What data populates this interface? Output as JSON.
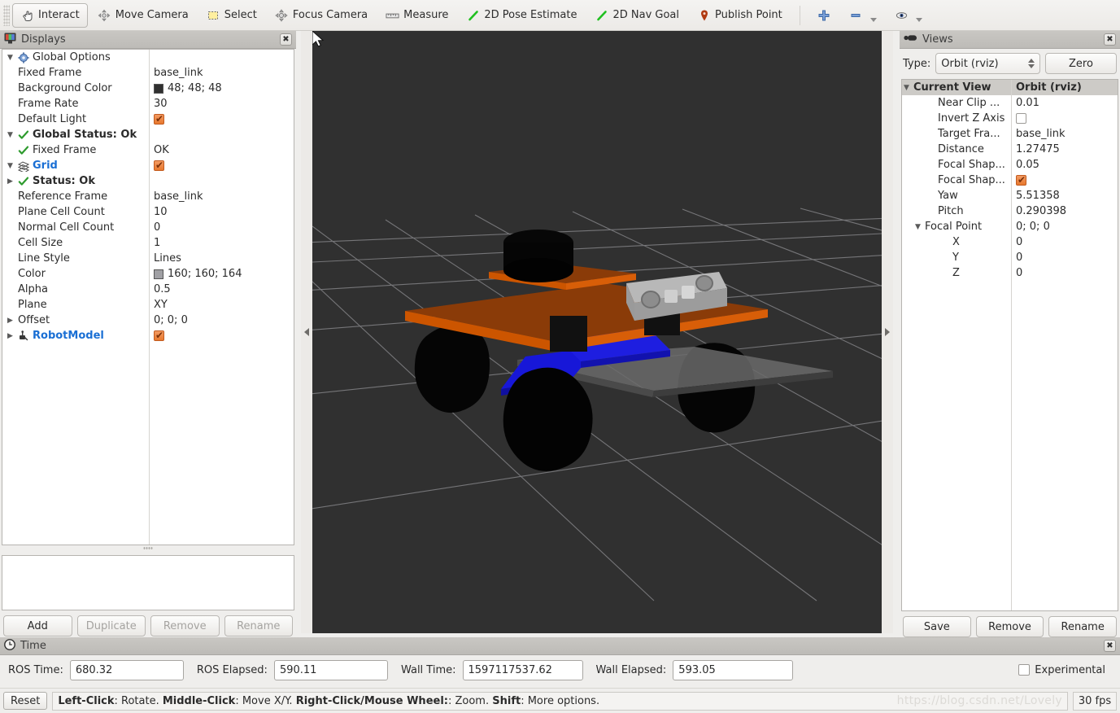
{
  "toolbar": {
    "items": [
      {
        "label": "Interact",
        "icon": "hand-icon",
        "active": true
      },
      {
        "label": "Move Camera",
        "icon": "move-camera-icon",
        "active": false
      },
      {
        "label": "Select",
        "icon": "select-icon",
        "active": false
      },
      {
        "label": "Focus Camera",
        "icon": "focus-camera-icon",
        "active": false
      },
      {
        "label": "Measure",
        "icon": "measure-icon",
        "active": false
      },
      {
        "label": "2D Pose Estimate",
        "icon": "pose-estimate-icon",
        "active": false
      },
      {
        "label": "2D Nav Goal",
        "icon": "nav-goal-icon",
        "active": false
      },
      {
        "label": "Publish Point",
        "icon": "publish-point-icon",
        "active": false
      }
    ],
    "right_icons": [
      "plus-icon",
      "minus-icon",
      "eye-icon"
    ]
  },
  "displays": {
    "title": "Displays",
    "title_icon": "displays-monitor-icon",
    "close_icon": "close-icon",
    "rows": [
      {
        "indent": 1,
        "tri": "▼",
        "icon": "gear-icon",
        "label": "Global Options",
        "value": "",
        "bold": false,
        "blue": false
      },
      {
        "indent": 2,
        "tri": "",
        "icon": "",
        "label": "Fixed Frame",
        "value": "base_link"
      },
      {
        "indent": 2,
        "tri": "",
        "icon": "",
        "label": "Background Color",
        "value": "48; 48; 48",
        "swatch": "#303030"
      },
      {
        "indent": 2,
        "tri": "",
        "icon": "",
        "label": "Frame Rate",
        "value": "30"
      },
      {
        "indent": 2,
        "tri": "",
        "icon": "",
        "label": "Default Light",
        "value": "",
        "checkbox": "on"
      },
      {
        "indent": 1,
        "tri": "▼",
        "icon": "check-icon",
        "label": "Global Status: Ok",
        "value": "",
        "bold": true
      },
      {
        "indent": 2,
        "tri": "",
        "icon": "check-icon",
        "label": "Fixed Frame",
        "value": "OK"
      },
      {
        "indent": 1,
        "tri": "▼",
        "icon": "grid-icon",
        "label": "Grid",
        "value": "",
        "blue": true,
        "checkbox": "on"
      },
      {
        "indent": 2,
        "tri": "▶",
        "icon": "check-icon",
        "label": "Status: Ok",
        "value": "",
        "bold": true
      },
      {
        "indent": 2,
        "tri": "",
        "icon": "",
        "label": "Reference Frame",
        "value": "base_link"
      },
      {
        "indent": 2,
        "tri": "",
        "icon": "",
        "label": "Plane Cell Count",
        "value": "10"
      },
      {
        "indent": 2,
        "tri": "",
        "icon": "",
        "label": "Normal Cell Count",
        "value": "0"
      },
      {
        "indent": 2,
        "tri": "",
        "icon": "",
        "label": "Cell Size",
        "value": "1"
      },
      {
        "indent": 2,
        "tri": "",
        "icon": "",
        "label": "Line Style",
        "value": "Lines"
      },
      {
        "indent": 2,
        "tri": "",
        "icon": "",
        "label": "Color",
        "value": "160; 160; 164",
        "swatch": "#a0a0a4"
      },
      {
        "indent": 2,
        "tri": "",
        "icon": "",
        "label": "Alpha",
        "value": "0.5"
      },
      {
        "indent": 2,
        "tri": "",
        "icon": "",
        "label": "Plane",
        "value": "XY"
      },
      {
        "indent": 2,
        "tri": "▶",
        "icon": "",
        "label": "Offset",
        "value": "0; 0; 0"
      },
      {
        "indent": 1,
        "tri": "▶",
        "icon": "robot-icon",
        "label": "RobotModel",
        "value": "",
        "blue": true,
        "checkbox": "on"
      }
    ],
    "buttons": [
      {
        "label": "Add",
        "enabled": true
      },
      {
        "label": "Duplicate",
        "enabled": false
      },
      {
        "label": "Remove",
        "enabled": false
      },
      {
        "label": "Rename",
        "enabled": false
      }
    ]
  },
  "views": {
    "title": "Views",
    "title_icon": "camera-icon",
    "close_icon": "close-icon",
    "type_label": "Type:",
    "type_value": "Orbit (rviz)",
    "zero_button": "Zero",
    "header": {
      "name": "Current View",
      "value": "Orbit (rviz)",
      "tri": "▼"
    },
    "rows": [
      {
        "indent": 3,
        "tri": "",
        "label": "Near Clip ...",
        "value": "0.01"
      },
      {
        "indent": 3,
        "tri": "",
        "label": "Invert Z Axis",
        "value": "",
        "checkbox": "off"
      },
      {
        "indent": 3,
        "tri": "",
        "label": "Target Fra...",
        "value": "base_link"
      },
      {
        "indent": 3,
        "tri": "",
        "label": "Distance",
        "value": "1.27475"
      },
      {
        "indent": 3,
        "tri": "",
        "label": "Focal Shap...",
        "value": "0.05"
      },
      {
        "indent": 3,
        "tri": "",
        "label": "Focal Shap...",
        "value": "",
        "checkbox": "on"
      },
      {
        "indent": 3,
        "tri": "",
        "label": "Yaw",
        "value": "5.51358"
      },
      {
        "indent": 3,
        "tri": "",
        "label": "Pitch",
        "value": "0.290398"
      },
      {
        "indent": 2,
        "tri": "▼",
        "label": "Focal Point",
        "value": "0; 0; 0"
      },
      {
        "indent": 4,
        "tri": "",
        "label": "X",
        "value": "0"
      },
      {
        "indent": 4,
        "tri": "",
        "label": "Y",
        "value": "0"
      },
      {
        "indent": 4,
        "tri": "",
        "label": "Z",
        "value": "0"
      }
    ],
    "buttons": [
      {
        "label": "Save"
      },
      {
        "label": "Remove"
      },
      {
        "label": "Rename"
      }
    ]
  },
  "time": {
    "title": "Time",
    "title_icon": "clock-icon",
    "close_icon": "close-icon",
    "fields": [
      {
        "label": "ROS Time:",
        "value": "680.32"
      },
      {
        "label": "ROS Elapsed:",
        "value": "590.11"
      },
      {
        "label": "Wall Time:",
        "value": "1597117537.62"
      },
      {
        "label": "Wall Elapsed:",
        "value": "593.05"
      }
    ],
    "experimental_label": "Experimental",
    "experimental_checked": false
  },
  "status": {
    "reset_button": "Reset",
    "hint_segments": [
      {
        "text": "Left-Click",
        "bold": true
      },
      {
        "text": ": Rotate.  ",
        "bold": false
      },
      {
        "text": "Middle-Click",
        "bold": true
      },
      {
        "text": ": Move X/Y.  ",
        "bold": false
      },
      {
        "text": "Right-Click/Mouse Wheel:",
        "bold": true
      },
      {
        "text": ": Zoom.  ",
        "bold": false
      },
      {
        "text": "Shift",
        "bold": true
      },
      {
        "text": ": More options.",
        "bold": false
      }
    ],
    "watermark": "https://blog.csdn.net/Lovely",
    "fps": "30 fps"
  },
  "viewport": {
    "background_color": "#303030",
    "grid_color": "#a0a0a4",
    "robot": {
      "plate_color": "#cc5500",
      "plate_top_color": "#8a3b08",
      "chassis_color": "#555555",
      "wheel_color": "#050505",
      "sensor_color": "#b0b0b0",
      "blue_part_color": "#1414d8"
    }
  },
  "colors": {
    "accent": "#cc5500",
    "link": "#1a6fd4",
    "ok": "#2e9b2e",
    "panel_bg": "#efeeec",
    "titlebar": "#c3c1bd"
  }
}
